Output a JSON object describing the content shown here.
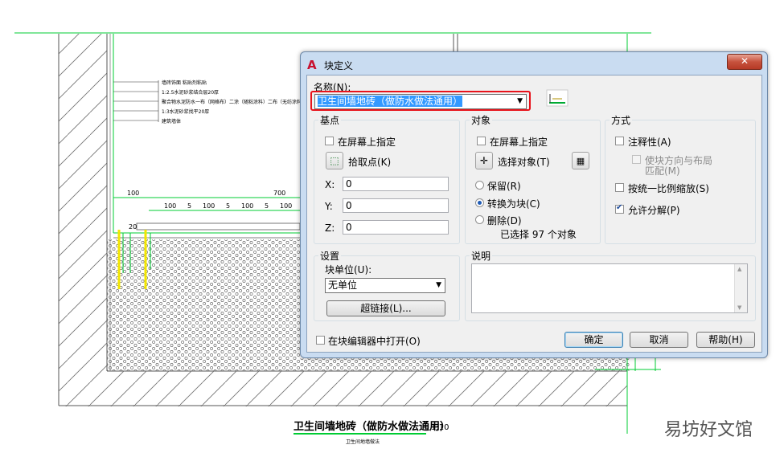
{
  "drawing": {
    "title": "卫生间墙地砖（做防水做法通用）",
    "scale": "1:10",
    "subtitle": "卫生间地墙做法",
    "layers": [
      "墙砖饰面 粘贴剂粘贴",
      "1:2.5水泥砂浆结合层20厚",
      "聚合物水泥防水一布（网格布）二涂（随粘涂料）二布（无纺涂料）",
      "1:3水泥砂浆找平20厚",
      "建筑墙体"
    ],
    "dims": {
      "top_left": "100",
      "top_mid": "700",
      "row": [
        "100",
        "5",
        "100",
        "5",
        "100",
        "5",
        "100"
      ],
      "side": "20"
    }
  },
  "dialog": {
    "title": "块定义",
    "close": "✕",
    "name_label": "名称(N):",
    "name_value": "卫生间墙地砖（做防水做法通用）",
    "basepoint": {
      "title": "基点",
      "specify": "在屏幕上指定",
      "pick": "拾取点(K)",
      "x_label": "X:",
      "x_value": "0",
      "y_label": "Y:",
      "y_value": "0",
      "z_label": "Z:",
      "z_value": "0"
    },
    "objects": {
      "title": "对象",
      "specify": "在屏幕上指定",
      "select": "选择对象(T)",
      "retain": "保留(R)",
      "convert": "转换为块(C)",
      "delete": "删除(D)",
      "count_text": "已选择 97 个对象"
    },
    "behavior": {
      "title": "方式",
      "annotative": "注释性(A)",
      "match_line1": "使块方向与布局",
      "match_line2": "匹配(M)",
      "uniform": "按统一比例缩放(S)",
      "explode": "允许分解(P)"
    },
    "settings": {
      "title": "设置",
      "unit_label": "块单位(U):",
      "unit_value": "无单位",
      "hyperlink": "超链接(L)..."
    },
    "description": {
      "title": "说明"
    },
    "open_in_editor": "在块编辑器中打开(O)",
    "ok": "确定",
    "cancel": "取消",
    "help": "帮助(H)"
  },
  "watermark": "易坊好文馆",
  "colors": {
    "highlight_border": "#e8131b",
    "selection": "#3399ff",
    "cad_green": "#00cc33",
    "cad_yellow": "#f2e600"
  }
}
